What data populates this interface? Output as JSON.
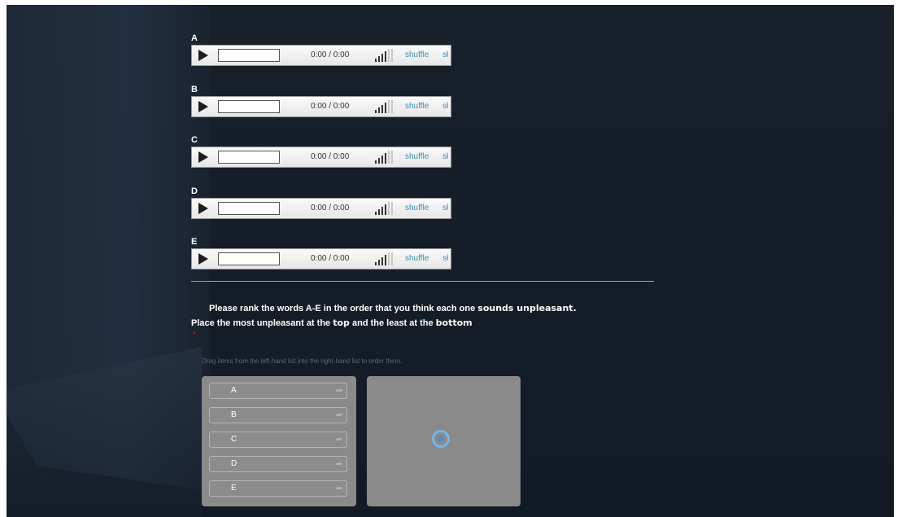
{
  "tracks": [
    {
      "label": "A",
      "time": "0:00 / 0:00",
      "shuffle": "shuffle",
      "shuffle2": "sł"
    },
    {
      "label": "B",
      "time": "0:00 / 0:00",
      "shuffle": "shuffle",
      "shuffle2": "sł"
    },
    {
      "label": "C",
      "time": "0:00 / 0:00",
      "shuffle": "shuffle",
      "shuffle2": "sł"
    },
    {
      "label": "D",
      "time": "0:00 / 0:00",
      "shuffle": "shuffle",
      "shuffle2": "sł"
    },
    {
      "label": "E",
      "time": "0:00 / 0:00",
      "shuffle": "shuffle",
      "shuffle2": "sł"
    }
  ],
  "question": {
    "line1_a": "Please rank the words A-E in the order that you think each one ",
    "line1_b": "sounds unpleasant.",
    "line2_a": "Place the most unpleasant at the ",
    "line2_b": "top",
    "line2_c": " and the least at the ",
    "line2_d": "bottom",
    "required_mark": "*"
  },
  "instruction": "Drag items from the left-hand list into the right-hand list to order them.",
  "ranking_items": [
    "A",
    "B",
    "C",
    "D",
    "E"
  ],
  "icons": {
    "play": "play-icon",
    "volume": "volume-icon",
    "arrow": "move-right-icon",
    "loading": "loading-spinner-icon"
  },
  "colors": {
    "background": "#141c27",
    "link": "#3b8fb0",
    "required": "#cc2222",
    "panel": "#8a8a8a"
  }
}
